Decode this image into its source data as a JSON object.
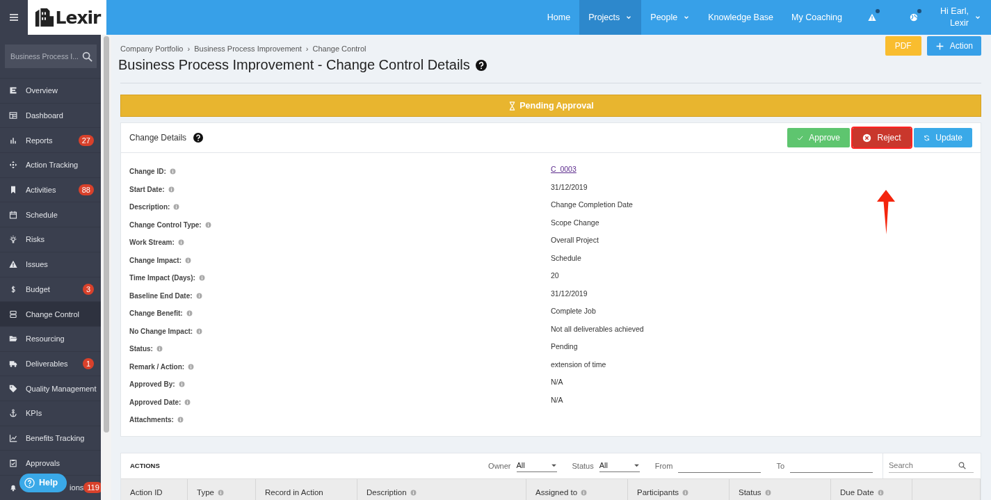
{
  "topbar": {
    "logo": "Lexir",
    "nav": [
      {
        "label": "Home",
        "selected": false,
        "dropdown": false
      },
      {
        "label": "Projects",
        "selected": true,
        "dropdown": true
      },
      {
        "label": "People",
        "selected": false,
        "dropdown": true
      },
      {
        "label": "Knowledge Base",
        "selected": false,
        "dropdown": false
      },
      {
        "label": "My Coaching",
        "selected": false,
        "dropdown": false
      }
    ],
    "alerts": [
      {
        "kind": "warning",
        "unread": true
      },
      {
        "kind": "globe",
        "unread": true
      }
    ],
    "user": {
      "greeting": "Hi Earl,",
      "name": "Lexir"
    }
  },
  "sidebar": {
    "search": {
      "value": "Business Process I..."
    },
    "items": [
      {
        "label": "Overview",
        "selected": false
      },
      {
        "label": "Dashboard",
        "selected": false
      },
      {
        "label": "Reports",
        "selected": false,
        "badge": "27"
      },
      {
        "label": "Action Tracking",
        "selected": false
      },
      {
        "label": "Activities",
        "selected": false,
        "badge": "88"
      },
      {
        "label": "Schedule",
        "selected": false
      },
      {
        "label": "Risks",
        "selected": false
      },
      {
        "label": "Issues",
        "selected": false
      },
      {
        "label": "Budget",
        "selected": false,
        "badge": "3"
      },
      {
        "label": "Change Control",
        "selected": true
      },
      {
        "label": "Resourcing",
        "selected": false
      },
      {
        "label": "Deliverables",
        "selected": false,
        "badge": "1"
      },
      {
        "label": "Quality Management",
        "selected": false
      },
      {
        "label": "KPIs",
        "selected": false
      },
      {
        "label": "Benefits Tracking",
        "selected": false
      },
      {
        "label": "Approvals",
        "selected": false
      },
      {
        "label": "ions",
        "selected": false,
        "badge": "119",
        "kind": "covered"
      }
    ]
  },
  "help": "Help",
  "breadcrumb": {
    "separator": "›",
    "items": [
      "Company Portfolio",
      "Business Process Improvement",
      "Change Control"
    ]
  },
  "title": "Business Process Improvement - Change Control Details",
  "header_buttons": [
    {
      "kind": "pdf",
      "label": "PDF"
    },
    {
      "kind": "add",
      "label": "Action"
    }
  ],
  "status_banner": "Pending Approval",
  "details": {
    "title": "Change Details",
    "buttons": [
      {
        "kind": "approve",
        "label": "Approve",
        "highlighted": false
      },
      {
        "kind": "reject",
        "label": "Reject",
        "highlighted": true
      },
      {
        "kind": "update",
        "label": "Update",
        "highlighted": false
      }
    ],
    "fields": [
      {
        "label": "Change ID:",
        "value": "C_0003",
        "kind": "link"
      },
      {
        "label": "Start Date:",
        "value": "31/12/2019",
        "kind": "text"
      },
      {
        "label": "Description:",
        "value": "Change Completion Date",
        "kind": "text"
      },
      {
        "label": "Change Control Type:",
        "value": "Scope Change",
        "kind": "text"
      },
      {
        "label": "Work Stream:",
        "value": "Overall Project",
        "kind": "text"
      },
      {
        "label": "Change Impact:",
        "value": "Schedule",
        "kind": "text"
      },
      {
        "label": "Time Impact (Days):",
        "value": "20",
        "kind": "text"
      },
      {
        "label": "Baseline End Date:",
        "value": "31/12/2019",
        "kind": "text"
      },
      {
        "label": "Change Benefit:",
        "value": "Complete Job",
        "kind": "text"
      },
      {
        "label": "No Change Impact:",
        "value": "Not all deliverables achieved",
        "kind": "text"
      },
      {
        "label": "Status:",
        "value": "Pending",
        "kind": "text"
      },
      {
        "label": "Remark / Action:",
        "value": "extension of time",
        "kind": "text"
      },
      {
        "label": "Approved By:",
        "value": "N/A",
        "kind": "text"
      },
      {
        "label": "Approved Date:",
        "value": "N/A",
        "kind": "text"
      },
      {
        "label": "Attachments:",
        "kind": "text"
      }
    ]
  },
  "actions": {
    "title": "ACTIONS",
    "filters": [
      {
        "label": "Owner",
        "kind": "select",
        "value": "All"
      },
      {
        "label": "Status",
        "kind": "select",
        "value": "All"
      },
      {
        "label": "From",
        "kind": "date"
      },
      {
        "label": "To",
        "kind": "date"
      }
    ],
    "search": {
      "placeholder": "Search"
    },
    "columns": [
      {
        "label": "Action ID",
        "info": false
      },
      {
        "label": "Type",
        "info": true
      },
      {
        "label": "Record in Action",
        "info": false
      },
      {
        "label": "Description",
        "info": true
      },
      {
        "label": "Assigned to",
        "info": true
      },
      {
        "label": "Participants",
        "info": true
      },
      {
        "label": "Status",
        "info": true
      },
      {
        "label": "Due Date",
        "info": true
      }
    ]
  }
}
